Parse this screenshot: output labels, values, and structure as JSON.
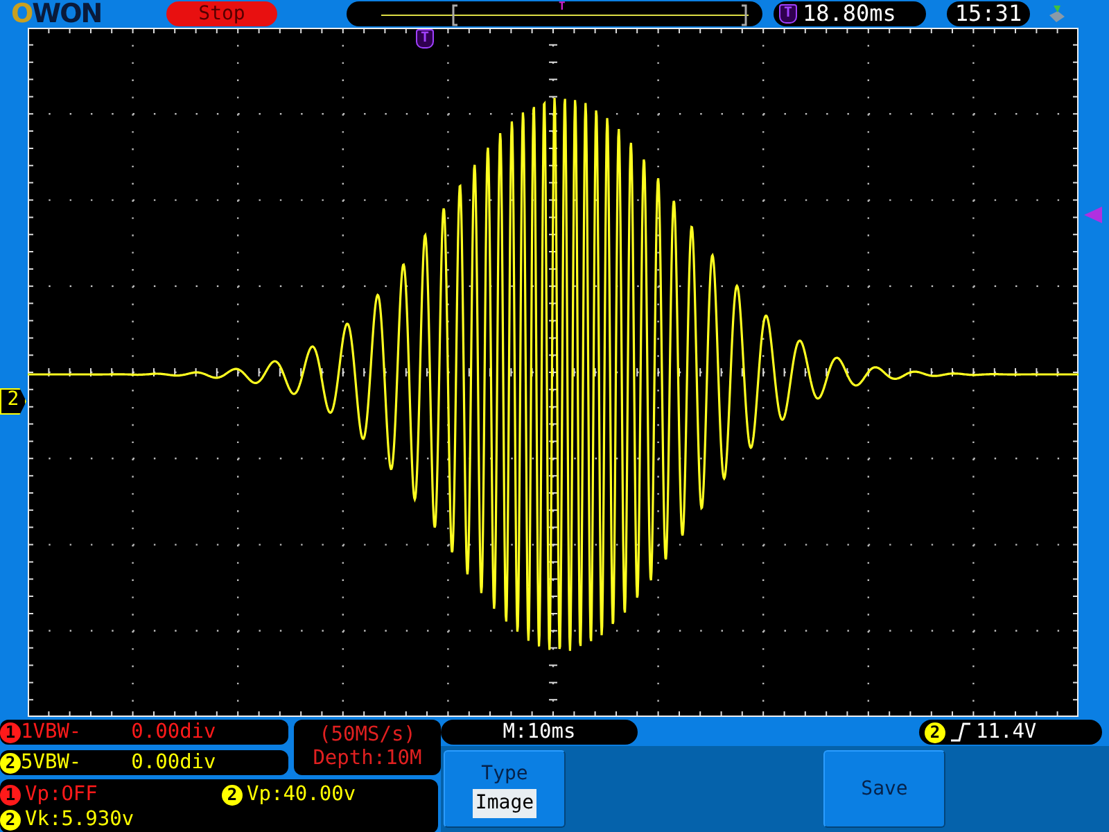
{
  "top_bar": {
    "logo": "OWON",
    "run_state": "Stop",
    "trigger_position_marker": "T",
    "trigger_time_badge": "T",
    "trigger_time": "18.80ms",
    "clock": "15:31"
  },
  "screen": {
    "trigger_marker": "T",
    "channel_marker": "2"
  },
  "cursor_readouts": [
    {
      "channel": "1",
      "color": "#ff1a1a",
      "label": "1VBW-",
      "value": "0.00div"
    },
    {
      "channel": "2",
      "color": "#ffff00",
      "label": "5VBW-",
      "value": "0.00div"
    }
  ],
  "acquisition": {
    "sample_rate": "(50MS/s)",
    "depth": "Depth:10M"
  },
  "measurements": [
    {
      "channel": "1",
      "color": "#ff1a1a",
      "text": "Vp:OFF"
    },
    {
      "channel": "2",
      "color": "#ffff00",
      "text": "Vp:40.00v"
    },
    {
      "channel": "2",
      "color": "#ffff00",
      "text": "Vk:5.930v"
    }
  ],
  "timebase": "M:10ms",
  "trigger": {
    "channel": "2",
    "color": "#ffff00",
    "level": "11.4V"
  },
  "menu": [
    {
      "kind": "option",
      "label": "Type",
      "value": "Image"
    },
    {
      "kind": "empty"
    },
    {
      "kind": "action",
      "label": "Save"
    }
  ]
}
